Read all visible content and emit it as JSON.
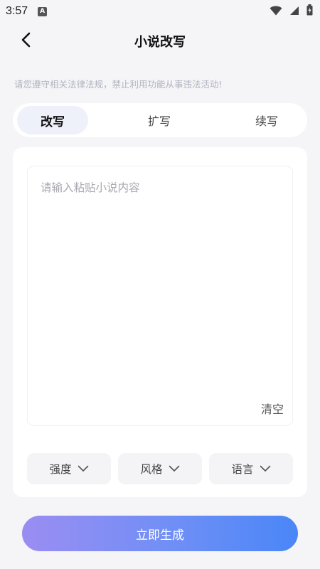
{
  "status_bar": {
    "time": "3:57",
    "badge": "A",
    "icons": [
      "wifi-icon",
      "signal-icon",
      "battery-icon"
    ]
  },
  "header": {
    "title": "小说改写",
    "back_icon": "chevron-left-icon"
  },
  "notice": "请您遵守相关法律法规，禁止利用功能从事违法活动!",
  "tabs": [
    {
      "label": "改写",
      "active": true
    },
    {
      "label": "扩写",
      "active": false
    },
    {
      "label": "续写",
      "active": false
    }
  ],
  "editor": {
    "placeholder": "请输入粘贴小说内容",
    "value": "",
    "clear_label": "清空"
  },
  "options": [
    {
      "label": "强度",
      "icon": "chevron-down-icon"
    },
    {
      "label": "风格",
      "icon": "chevron-down-icon"
    },
    {
      "label": "语言",
      "icon": "chevron-down-icon"
    }
  ],
  "generate_label": "立即生成",
  "colors": {
    "background": "#f5f5f7",
    "active_tab": "#eef0fa",
    "gradient_start": "#9b8df2",
    "gradient_end": "#4a86f7",
    "notice_text": "#b0b3c0"
  }
}
